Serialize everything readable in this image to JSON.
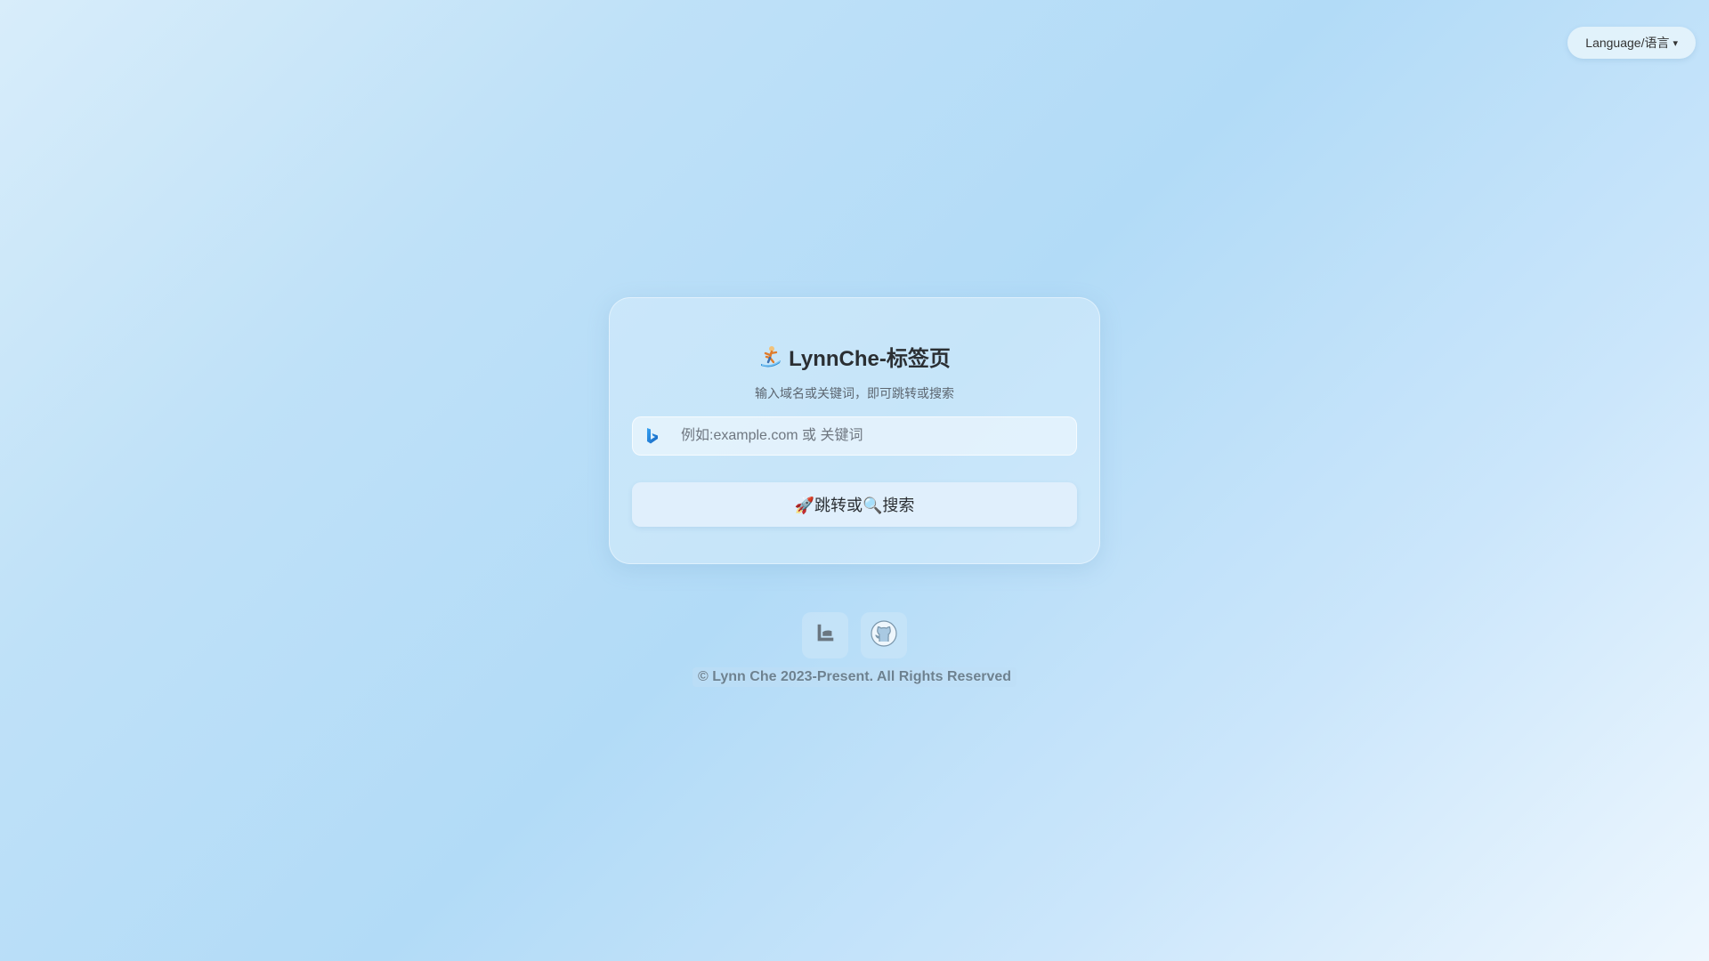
{
  "language_button": {
    "label": "Language/语言",
    "caret": "▾"
  },
  "card": {
    "title_icon": "surfer-icon",
    "title": "LynnChe-标签页",
    "subtitle": "输入域名或关键词，即可跳转或搜索",
    "search": {
      "engine_icon": "bing-icon",
      "placeholder": "例如:example.com 或 关键词",
      "value": ""
    },
    "go_button": {
      "label": "🚀跳转或🔍搜索"
    }
  },
  "footer": {
    "links": [
      {
        "icon": "blog-logo-icon"
      },
      {
        "icon": "github-icon"
      }
    ],
    "copyright": "© Lynn Che 2023-Present. All Rights Reserved"
  },
  "colors": {
    "background_start": "#d8edfa",
    "background_mid": "#b2dbf7",
    "background_end": "#eef7fe",
    "bing_blue": "#1a8ee6"
  }
}
